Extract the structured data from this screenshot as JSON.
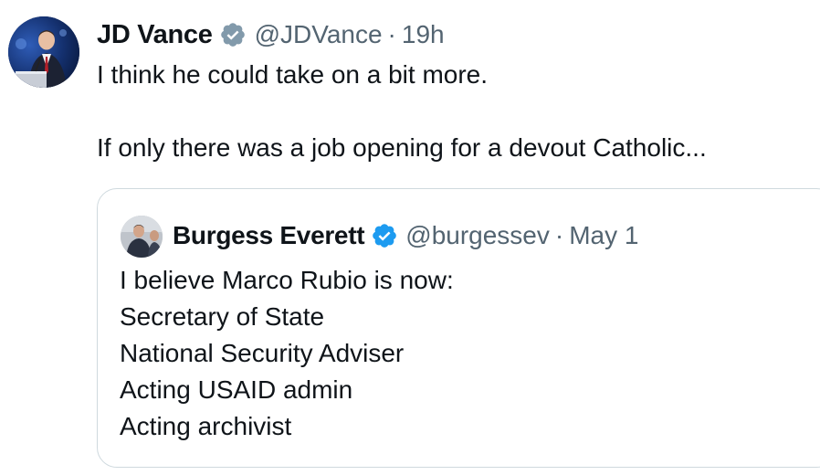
{
  "tweet": {
    "author": {
      "name": "JD Vance",
      "handle": "@JDVance",
      "verified_color": "#829aab",
      "avatar_icon": "person-speaking-avatar"
    },
    "separator": "·",
    "time": "19h",
    "text_lines": [
      "I think he could take on a bit more.",
      "",
      "If only there was a job opening for a devout Catholic..."
    ]
  },
  "quoted_tweet": {
    "author": {
      "name": "Burgess Everett",
      "handle": "@burgessev",
      "verified_color": "#1d9bf0",
      "avatar_icon": "person-avatar"
    },
    "separator": "·",
    "time": "May 1",
    "text_lines": [
      "I believe Marco Rubio is now:",
      "Secretary of State",
      "National Security Adviser",
      "Acting USAID admin",
      "Acting archivist"
    ]
  },
  "colors": {
    "text": "#0f1419",
    "secondary_text": "#536471",
    "border": "#cfd9de"
  }
}
